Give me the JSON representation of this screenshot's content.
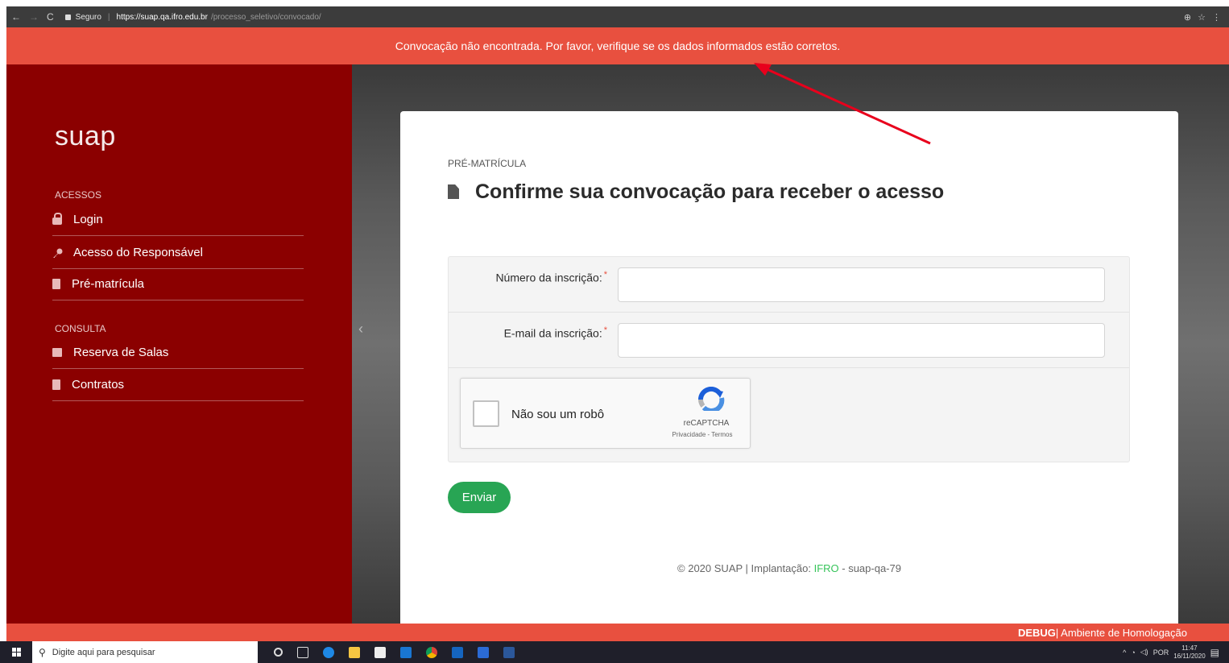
{
  "browser": {
    "secure_label": "Seguro",
    "url_host": "https://suap.qa.ifro.edu.br",
    "url_path": "/processo_seletivo/convocado/"
  },
  "alert": {
    "message": "Convocação não encontrada. Por favor, verifique se os dados informados estão corretos."
  },
  "sidebar": {
    "logo": "suap",
    "sections": [
      {
        "title": "ACESSOS",
        "items": [
          {
            "label": "Login",
            "icon": "lock-icon"
          },
          {
            "label": "Acesso do Responsável",
            "icon": "key-icon"
          },
          {
            "label": "Pré-matrícula",
            "icon": "document-icon"
          }
        ]
      },
      {
        "title": "CONSULTA",
        "items": [
          {
            "label": "Reserva de Salas",
            "icon": "calendar-icon"
          },
          {
            "label": "Contratos",
            "icon": "contract-icon"
          }
        ]
      }
    ]
  },
  "page": {
    "breadcrumb": "PRÉ-MATRÍCULA",
    "title": "Confirme sua convocação para receber o acesso",
    "title_icon": "document-icon"
  },
  "form": {
    "inscription_label": "Número da inscrição:",
    "inscription_value": "",
    "email_label": "E-mail da inscrição:",
    "email_value": "",
    "required_mark": "*",
    "captcha_label": "Não sou um robô",
    "captcha_brand": "reCAPTCHA",
    "captcha_links": "Privacidade - Termos",
    "submit_label": "Enviar"
  },
  "footer": {
    "prefix": "© 2020 SUAP | Implantação: ",
    "org": "IFRO",
    "suffix": " - suap-qa-79"
  },
  "debug_bar": {
    "label": "DEBUG",
    "text": " | Ambiente de Homologação"
  },
  "taskbar": {
    "search_placeholder": "Digite aqui para pesquisar",
    "language": "POR",
    "time": "11:47",
    "date": "16/11/2020"
  },
  "colors": {
    "alert": "#e8503f",
    "sidebar": "#8b0000",
    "submit": "#28a554",
    "annotation_arrow": "#e8001c"
  }
}
